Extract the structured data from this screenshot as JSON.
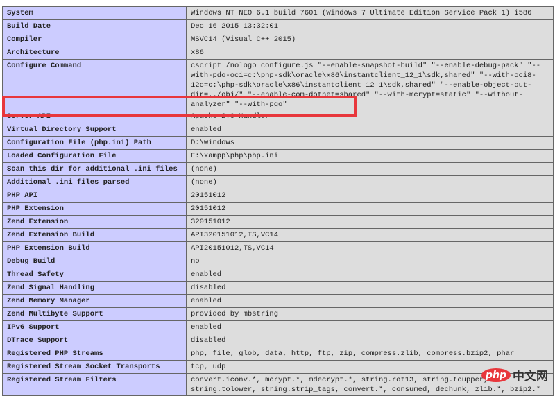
{
  "rows": [
    {
      "key": "System",
      "value": "Windows NT NEO 6.1 build 7601 (Windows 7 Ultimate Edition Service Pack 1) i586"
    },
    {
      "key": "Build Date",
      "value": "Dec 16 2015 13:32:01"
    },
    {
      "key": "Compiler",
      "value": "MSVC14 (Visual C++ 2015)"
    },
    {
      "key": "Architecture",
      "value": "x86"
    },
    {
      "key": "Configure Command",
      "value": "cscript /nologo configure.js \"--enable-snapshot-build\" \"--enable-debug-pack\" \"--with-pdo-oci=c:\\php-sdk\\oracle\\x86\\instantclient_12_1\\sdk,shared\" \"--with-oci8-12c=c:\\php-sdk\\oracle\\x86\\instantclient_12_1\\sdk,shared\" \"--enable-object-out-dir=../obj/\" \"--enable-com-dotnet=shared\" \"--with-mcrypt=static\" \"--without-analyzer\" \"--with-pgo\""
    },
    {
      "key": "Server API",
      "value": "Apache 2.0 Handler"
    },
    {
      "key": "Virtual Directory Support",
      "value": "enabled"
    },
    {
      "key": "Configuration File (php.ini) Path",
      "value": "D:\\windows"
    },
    {
      "key": "Loaded Configuration File",
      "value": "E:\\xampp\\php\\php.ini"
    },
    {
      "key": "Scan this dir for additional .ini files",
      "value": "(none)"
    },
    {
      "key": "Additional .ini files parsed",
      "value": "(none)"
    },
    {
      "key": "PHP API",
      "value": "20151012"
    },
    {
      "key": "PHP Extension",
      "value": "20151012"
    },
    {
      "key": "Zend Extension",
      "value": "320151012"
    },
    {
      "key": "Zend Extension Build",
      "value": "API320151012,TS,VC14"
    },
    {
      "key": "PHP Extension Build",
      "value": "API20151012,TS,VC14"
    },
    {
      "key": "Debug Build",
      "value": "no"
    },
    {
      "key": "Thread Safety",
      "value": "enabled"
    },
    {
      "key": "Zend Signal Handling",
      "value": "disabled"
    },
    {
      "key": "Zend Memory Manager",
      "value": "enabled"
    },
    {
      "key": "Zend Multibyte Support",
      "value": "provided by mbstring"
    },
    {
      "key": "IPv6 Support",
      "value": "enabled"
    },
    {
      "key": "DTrace Support",
      "value": "disabled"
    },
    {
      "key": "Registered PHP Streams",
      "value": "php, file, glob, data, http, ftp, zip, compress.zlib, compress.bzip2, phar"
    },
    {
      "key": "Registered Stream Socket Transports",
      "value": "tcp, udp"
    },
    {
      "key": "Registered Stream Filters",
      "value": "convert.iconv.*, mcrypt.*, mdecrypt.*, string.rot13, string.toupper, string.tolower, string.strip_tags, convert.*, consumed, dechunk, zlib.*, bzip2.*"
    }
  ],
  "highlight_color": "#e8373c",
  "watermark": {
    "logo": "php",
    "text": "中文网"
  }
}
